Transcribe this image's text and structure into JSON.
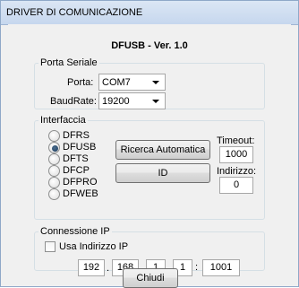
{
  "window": {
    "title": "DRIVER DI COMUNICAZIONE"
  },
  "app_title": "DFUSB - Ver. 1.0",
  "serial": {
    "group_label": "Porta Seriale",
    "port_label": "Porta:",
    "port_value": "COM7",
    "baud_label": "BaudRate:",
    "baud_value": "19200"
  },
  "interface": {
    "group_label": "Interfaccia",
    "options": [
      "DFRS",
      "DFUSB",
      "DFTS",
      "DFCP",
      "DFPRO",
      "DFWEB"
    ],
    "selected": "DFUSB",
    "auto_search_label": "Ricerca Automatica",
    "id_label": "ID",
    "timeout_label": "Timeout:",
    "timeout_value": "1000",
    "address_label": "Indirizzo:",
    "address_value": "0"
  },
  "ip": {
    "group_label": "Connessione IP",
    "use_ip_label": "Usa Indirizzo IP",
    "use_ip_checked": false,
    "octets": [
      "192",
      "168",
      "1",
      "1"
    ],
    "port": "1001",
    "dot": ".",
    "colon": ":"
  },
  "footer": {
    "close_label": "Chiudi"
  }
}
